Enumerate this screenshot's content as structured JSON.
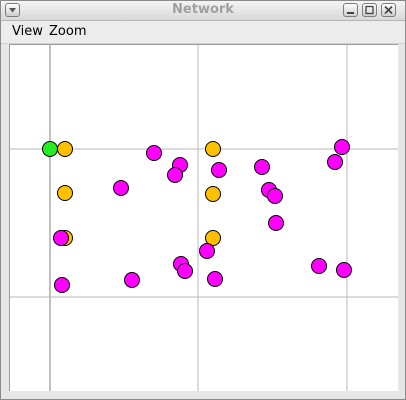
{
  "window": {
    "title": "Network"
  },
  "menu": {
    "items": [
      "View",
      "Zoom"
    ]
  },
  "graph": {
    "node_colors": {
      "magenta": "#ff00ff",
      "orange": "#ffc000",
      "green": "#22ee22"
    }
  }
}
